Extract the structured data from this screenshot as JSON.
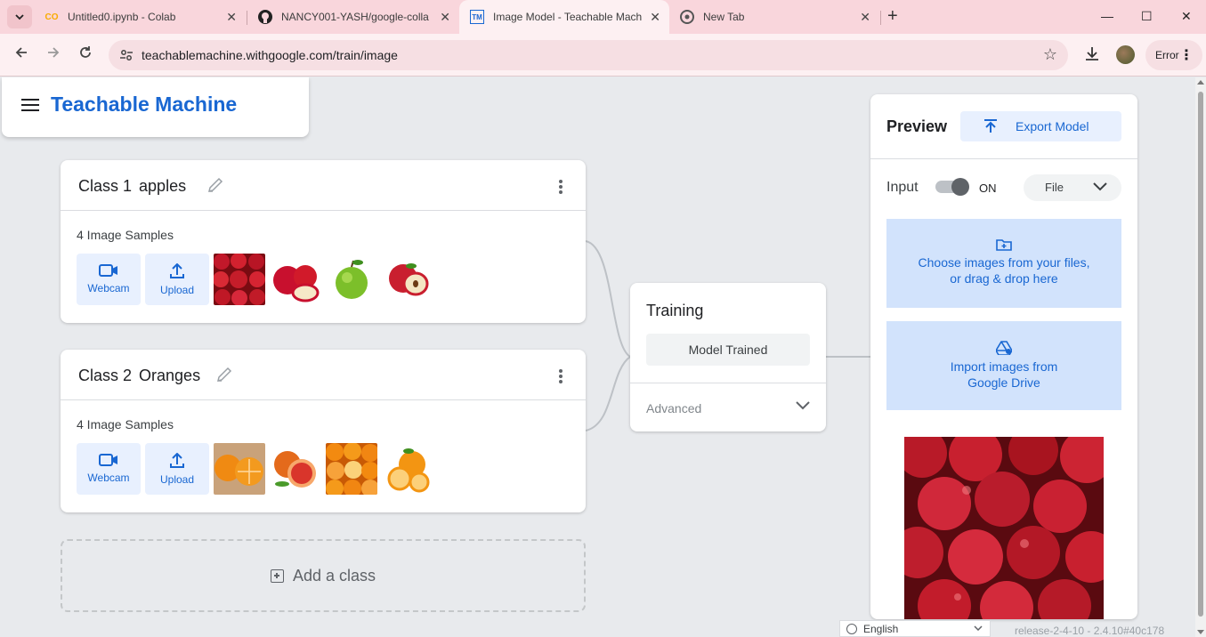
{
  "browser": {
    "tabs": [
      {
        "title": "Untitled0.ipynb - Colab",
        "favicon": "colab-icon",
        "active": false
      },
      {
        "title": "NANCY001-YASH/google-colla",
        "favicon": "github-icon",
        "active": false
      },
      {
        "title": "Image Model - Teachable Mach",
        "favicon": "tm-icon",
        "active": true
      },
      {
        "title": "New Tab",
        "favicon": "chrome-icon",
        "active": false
      }
    ],
    "url": "teachablemachine.withgoogle.com/train/image",
    "error_label": "Error"
  },
  "app": {
    "brand": "Teachable Machine"
  },
  "classes": [
    {
      "number_label": "Class 1",
      "name": "apples",
      "samples": "4 Image Samples",
      "webcam": "Webcam",
      "upload": "Upload"
    },
    {
      "number_label": "Class 2",
      "name": "Oranges",
      "samples": "4 Image Samples",
      "webcam": "Webcam",
      "upload": "Upload"
    }
  ],
  "add_class": "Add a class",
  "training": {
    "title": "Training",
    "button": "Model Trained",
    "advanced": "Advanced"
  },
  "preview": {
    "title": "Preview",
    "export": "Export Model",
    "input_label": "Input",
    "toggle_state": "ON",
    "source": "File",
    "choose_line1": "Choose images from your files,",
    "choose_line2": "or drag & drop here",
    "drive_line1": "Import images from",
    "drive_line2": "Google Drive"
  },
  "footer": {
    "language": "English",
    "release": "release-2-4-10 - 2.4.10#40c178"
  },
  "colors": {
    "accent": "#1967d2",
    "accent_light": "#e8f0fe",
    "drop_bg": "#d2e3fc",
    "page_bg": "#e8eaed",
    "tabbar_bg": "#f9d6dc"
  }
}
